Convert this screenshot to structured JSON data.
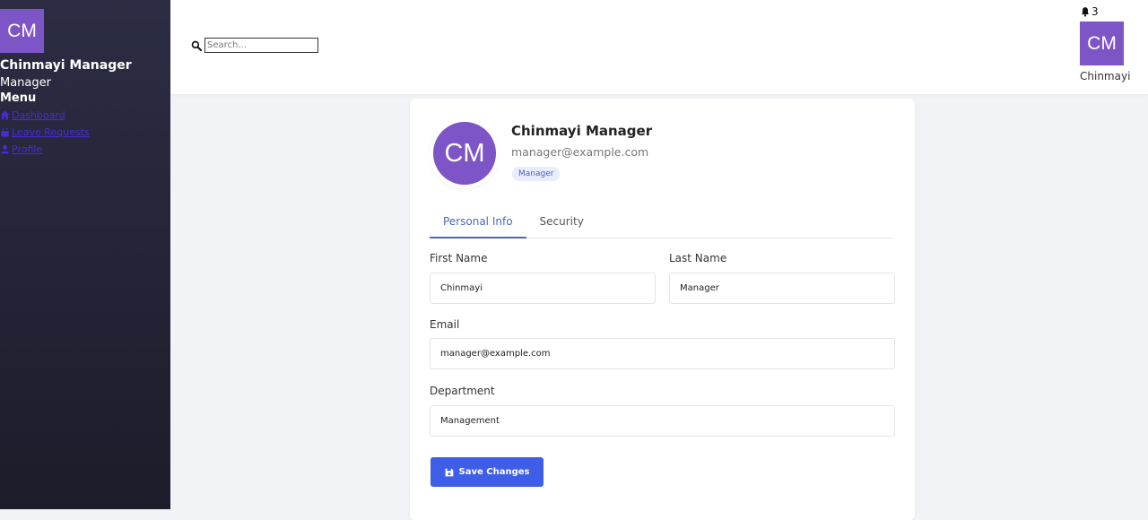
{
  "sidebar": {
    "avatar_initials": "CM",
    "user_name": "Chinmayi Manager",
    "user_role": "Manager",
    "menu_title": "Menu",
    "items": [
      {
        "label": "Dashboard",
        "icon": "home-icon"
      },
      {
        "label": "Leave Requests",
        "icon": "calendar-icon"
      },
      {
        "label": "Profile",
        "icon": "user-icon"
      }
    ]
  },
  "header": {
    "search_placeholder": "Search...",
    "notification_count": "3",
    "avatar_initials": "CM",
    "user_first_name": "Chinmayi"
  },
  "profile": {
    "avatar_initials": "CM",
    "name": "Chinmayi Manager",
    "email": "manager@example.com",
    "role_badge": "Manager"
  },
  "tabs": [
    {
      "label": "Personal Info",
      "active": true
    },
    {
      "label": "Security",
      "active": false
    }
  ],
  "form": {
    "first_name_label": "First Name",
    "first_name_value": "Chinmayi",
    "last_name_label": "Last Name",
    "last_name_value": "Manager",
    "email_label": "Email",
    "email_value": "manager@example.com",
    "department_label": "Department",
    "department_value": "Management",
    "save_label": "Save Changes"
  },
  "colors": {
    "accent": "#3f5ee8",
    "avatar": "#7d55c7",
    "sidebar_bg": "#2c2d44",
    "link": "#4b2ad8"
  }
}
